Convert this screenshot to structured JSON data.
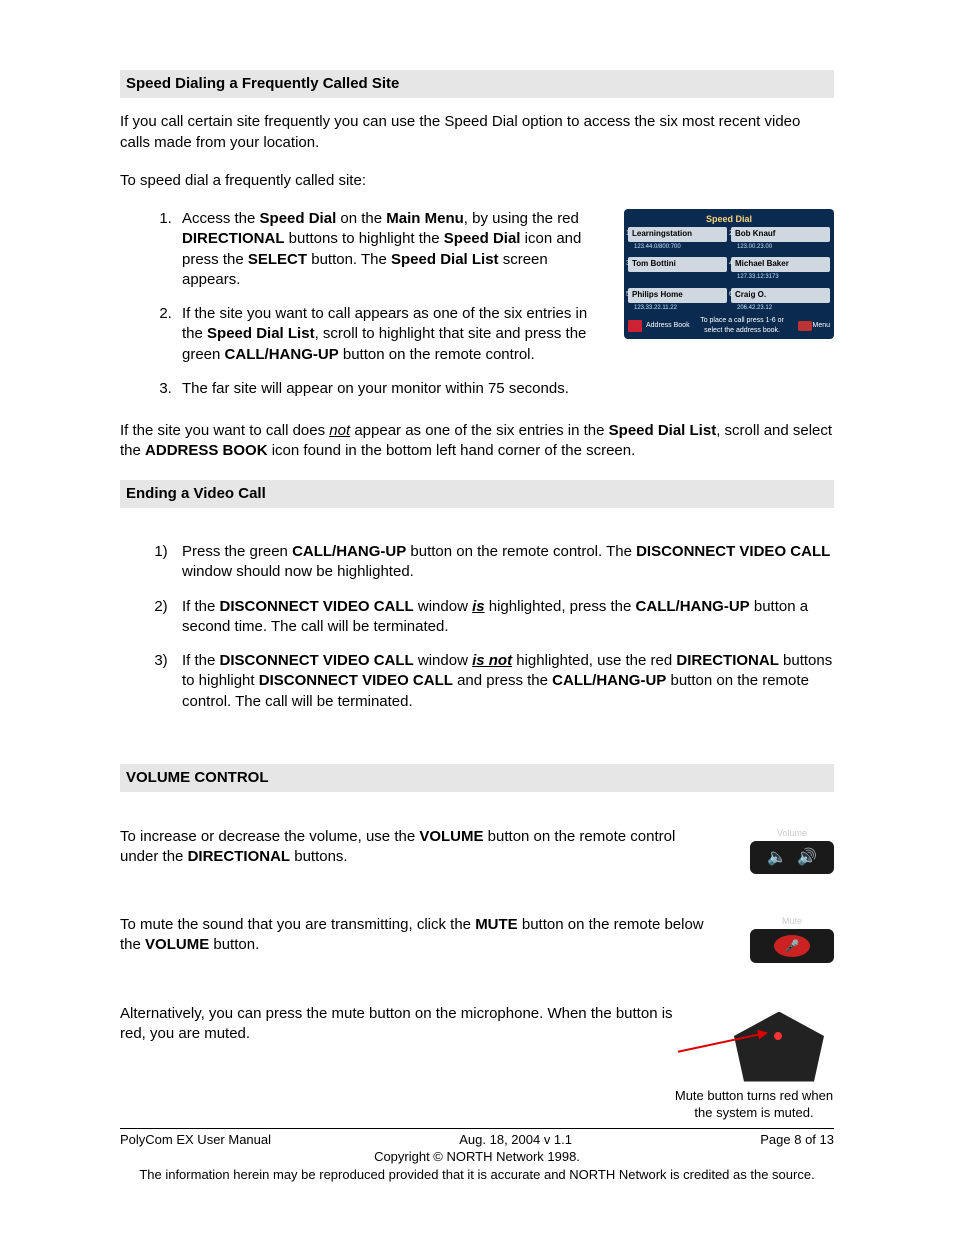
{
  "section1": {
    "title": "Speed Dialing a Frequently Called Site",
    "intro": "If you call certain site frequently you can use the Speed Dial option to access the six most recent video calls made from your location.",
    "lead": "To speed dial a frequently called site:",
    "steps": {
      "s1": {
        "a": "Access the ",
        "b": "Speed Dial",
        "c": " on the ",
        "d": "Main Menu",
        "e": ", by using the red ",
        "f": "DIRECTIONAL",
        "g": " buttons to highlight the ",
        "h": "Speed Dial",
        "i": " icon and press the ",
        "j": "SELECT",
        "k": " button. The ",
        "l": "Speed Dial List",
        "m": " screen appears."
      },
      "s2": {
        "a": "If the site you want to call appears as one of the six entries in the ",
        "b": "Speed Dial List",
        "c": ", scroll to highlight that site and press the green ",
        "d": "CALL/HANG-UP",
        "e": " button on the remote control."
      },
      "s3": "The far site will appear on your monitor within 75 seconds."
    },
    "box": {
      "title": "Speed Dial",
      "cells": [
        {
          "n": "1",
          "name": "Learningstation",
          "sub": "123.44.0/800:700"
        },
        {
          "n": "2",
          "name": "Bob Knauf",
          "sub": "123.00.23.00"
        },
        {
          "n": "3",
          "name": "Tom Bottini",
          "sub": ""
        },
        {
          "n": "4",
          "name": "Michael Baker",
          "sub": "127.33.12:3173"
        },
        {
          "n": "5",
          "name": "Philips Home",
          "sub": "123.33.22.11.22"
        },
        {
          "n": "6",
          "name": "Craig O.",
          "sub": "206.42.23.12"
        }
      ],
      "addr": "Address Book",
      "hint": "To place a call press 1-6 or select the address book.",
      "menu": "Menu"
    },
    "after": {
      "a": "If the site you want to call does ",
      "not": "not",
      "b": " appear as one of the six entries in the ",
      "c": "Speed Dial List",
      "d": ", scroll and select the ",
      "e": "ADDRESS BOOK",
      "f": " icon found in the bottom left hand corner of the screen."
    }
  },
  "section2": {
    "title": "Ending a Video Call",
    "steps": {
      "s1": {
        "a": "Press the green ",
        "b": "CALL/HANG-UP",
        "c": " button on the remote control. The ",
        "d": "DISCONNECT VIDEO CALL",
        "e": " window should now be highlighted."
      },
      "s2": {
        "a": "If the ",
        "b": "DISCONNECT VIDEO CALL",
        "c": " window ",
        "is": "is",
        "d": " highlighted, press the ",
        "e": "CALL/HANG-UP",
        "f": " button a second time. The call will be terminated."
      },
      "s3": {
        "a": "If the ",
        "b": "DISCONNECT VIDEO CALL",
        "c": " window ",
        "isnot": "is not",
        "d": " highlighted, use the red ",
        "e": "DIRECTIONAL",
        "f": " buttons to highlight ",
        "g": "DISCONNECT VIDEO CALL",
        "h": " and press the ",
        "i": "CALL/HANG-UP",
        "j": " button on the remote control. The call will be terminated."
      }
    }
  },
  "section3": {
    "title": "VOLUME CONTROL",
    "p1": {
      "a": "To increase or decrease the volume, use the ",
      "b": "VOLUME",
      "c": " button on the remote control under the ",
      "d": "DIRECTIONAL",
      "e": " buttons."
    },
    "p2": {
      "a": "To mute the sound that you are transmitting, click the ",
      "b": "MUTE",
      "c": " button on the remote below the ",
      "d": "VOLUME",
      "e": " button."
    },
    "p3": "Alternatively, you can press the mute button on the microphone.  When the button is red, you are muted.",
    "caption": "Mute button turns red when the system is muted.",
    "volLabel": "Volume",
    "muteLabel": "Mute"
  },
  "footer": {
    "left": "PolyCom EX User Manual",
    "mid": "Aug. 18, 2004     v 1.1",
    "right": "Page 8 of 13",
    "copy": "Copyright © NORTH Network 1998.",
    "disc": "The information herein may be reproduced provided that it is accurate and NORTH Network is credited as the source."
  }
}
